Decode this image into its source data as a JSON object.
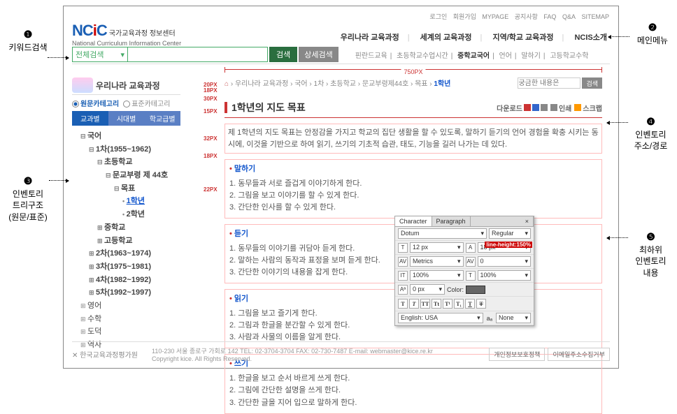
{
  "callouts": {
    "c1_num": "❶",
    "c1_text": "키워드검색",
    "c2_num": "❷",
    "c2_text": "메인메뉴",
    "c3_num": "❸",
    "c3_text1": "인벤토리",
    "c3_text2": "트리구조",
    "c3_text3": "(원문/표준)",
    "c4_num": "❹",
    "c4_text1": "인벤토리",
    "c4_text2": "주소/경로",
    "c5_num": "❺",
    "c5_text1": "최하위",
    "c5_text2": "인벤토리",
    "c5_text3": "내용"
  },
  "topnav": {
    "login": "로그인",
    "join": "회원가입",
    "mypage": "MYPAGE",
    "notice": "공지사항",
    "faq": "FAQ",
    "qna": "Q&A",
    "sitemap": "SITEMAP"
  },
  "logo": {
    "main": "NCiC",
    "kr": "국가교육과정 정보센터",
    "en": "National Curriculum Information Center"
  },
  "mainmenu": {
    "m1": "우리나라 교육과정",
    "m2": "세계의 교육과정",
    "m3": "지역/학교 교육과정",
    "m4": "NCIS소개"
  },
  "search": {
    "select": "전체검색",
    "btn": "검색",
    "adv": "상세검색",
    "links": {
      "l1": "핀란드교육",
      "l2": "초등학교수업시간",
      "l3": "중학교국어",
      "l4": "언어",
      "l5": "말하기",
      "l6": "고등학교수학"
    }
  },
  "ruler750": "750PX",
  "sidebar": {
    "title": "우리나라 교육과정",
    "cat_on": "원문카테고리",
    "cat_off": "표준카테고리",
    "tabs": {
      "t1": "교과별",
      "t2": "시대별",
      "t3": "학교급별"
    },
    "tree": {
      "root": "국어",
      "n1": "1차(1955~1962)",
      "n1_1": "초등학교",
      "n1_1_1": "문교부령 제 44호",
      "n1_1_1_1": "목표",
      "n1_1_1_1_1": "1학년",
      "n1_1_1_1_2": "2학년",
      "n1_2": "중학교",
      "n1_3": "고등학교",
      "n2": "2차(1963~1974)",
      "n3": "3차(1975~1981)",
      "n4": "4차(1982~1992)",
      "n5": "5차(1992~1997)",
      "s2": "영어",
      "s3": "수학",
      "s4": "도덕",
      "s5": "역사"
    }
  },
  "breadcrumb": {
    "home": "⌂",
    "p1": "우리나라 교육과정",
    "p2": "국어",
    "p3": "1차",
    "p4": "초등학교",
    "p5": "문교부령제44호",
    "p6": "목표",
    "last": "1학년",
    "input_ph": "궁금한 내용은",
    "btn": "검색"
  },
  "page": {
    "title": "1학년의 지도 목표",
    "actions": {
      "dl": "다운로드",
      "print": "인쇄",
      "scrap": "스크랩"
    },
    "intro": "제 1학년의 지도 목표는 안정감을 가지고 학교의 집단 생활을 할 수 있도록, 말하기 듣기의 언어 경험을 확충 시키는 동시에, 이것을 기반으로 하여 읽기, 쓰기의 기초적 습관, 태도, 기능을 길러 나가는 데 있다.",
    "sec1": {
      "h": "말하기",
      "i1": "동무들과 서로 즐겁게 이야기하게 한다.",
      "i2": "그림을 보고 이야기를 할 수 있게 한다.",
      "i3": "간단한 인사를 할 수 있게 한다."
    },
    "sec2": {
      "h": "듣기",
      "i1": "동무들의 이야기를 귀담아 듣게 한다.",
      "i2": "말하는 사람의 동작과 표정을 보며 듣게 한다.",
      "i3": "간단한 이야기의 내용을 잡게 한다."
    },
    "sec3": {
      "h": "읽기",
      "i1": "그림을 보고 즐기게 한다.",
      "i2": "그림과 한글을 분간할 수 있게 한다.",
      "i3": "사람과 사물의 이름을 알게 한다."
    },
    "sec4": {
      "h": "쓰기",
      "i1": "한글을 보고 순서 바르게 쓰게 한다.",
      "i2": "그림에 간단한 설명을 쓰게 한다.",
      "i3": "간단한 글을 지어 입으로 말하게 한다."
    }
  },
  "redmarks": {
    "m1": "20PX",
    "m1b": "18PX",
    "m2": "30PX",
    "m3": "15PX",
    "m4": "32PX",
    "m5": "18PX",
    "m6": "22PX"
  },
  "charpanel": {
    "tab1": "Character",
    "tab2": "Paragraph",
    "close": "×",
    "font": "Dotum",
    "weight": "Regular",
    "size": "12 px",
    "leading": "18 px",
    "metrics": "Metrics",
    "hl": "line-height:150%",
    "scaleV": "100%",
    "scaleH": "100%",
    "baseline": "0 px",
    "colorlbl": "Color:",
    "color": "#666666",
    "lang_lbl": "English: USA",
    "aa_lbl": "None"
  },
  "footer": {
    "logo": "한국교육과정평가원",
    "addr": "110-230 서울 종로구 가회로 142  TEL: 02-3704-3704  FAX: 02-730-7487  E-mail: webmaster@kice.re.kr",
    "copy": "Copyright kice. All Rights Reserved.",
    "b1": "개인정보보호정책",
    "b2": "이메일주소수집거부"
  }
}
